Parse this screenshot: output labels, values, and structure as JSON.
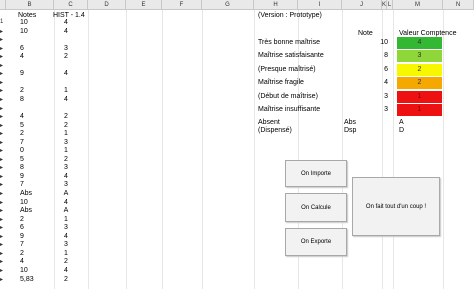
{
  "columns": [
    "B",
    "C",
    "D",
    "E",
    "F",
    "G",
    "H",
    "I",
    "J",
    "K",
    "L",
    "M",
    "N"
  ],
  "col_headers": {
    "B": "Notes",
    "C": "HIST - 1.4"
  },
  "rows": [
    {
      "a": "1",
      "b": "10",
      "c": "4"
    },
    {
      "a": "▸",
      "b": "10",
      "c": "4"
    },
    {
      "a": "▸",
      "b": "",
      "c": ""
    },
    {
      "a": "▸",
      "b": "6",
      "c": "3"
    },
    {
      "a": "▸",
      "b": "4",
      "c": "2"
    },
    {
      "a": "▸",
      "b": "",
      "c": ""
    },
    {
      "a": "▸",
      "b": "9",
      "c": "4"
    },
    {
      "a": "▸",
      "b": "",
      "c": ""
    },
    {
      "a": "▸",
      "b": "2",
      "c": "1"
    },
    {
      "a": "▸",
      "b": "8",
      "c": "4"
    },
    {
      "a": "▸",
      "b": "",
      "c": ""
    },
    {
      "a": "▸",
      "b": "4",
      "c": "2"
    },
    {
      "a": "▸",
      "b": "5",
      "c": "2"
    },
    {
      "a": "▸",
      "b": "2",
      "c": "1"
    },
    {
      "a": "▸",
      "b": "7",
      "c": "3"
    },
    {
      "a": "▸",
      "b": "0",
      "c": "1"
    },
    {
      "a": "▸",
      "b": "5",
      "c": "2"
    },
    {
      "a": "▸",
      "b": "8",
      "c": "3"
    },
    {
      "a": "▸",
      "b": "9",
      "c": "4"
    },
    {
      "a": "▸",
      "b": "7",
      "c": "3"
    },
    {
      "a": "▸",
      "b": "Abs",
      "c": "A"
    },
    {
      "a": "▸",
      "b": "10",
      "c": "4"
    },
    {
      "a": "▸",
      "b": "Abs",
      "c": "A"
    },
    {
      "a": "▸",
      "b": "2",
      "c": "1"
    },
    {
      "a": "▸",
      "b": "6",
      "c": "3"
    },
    {
      "a": "▸",
      "b": "9",
      "c": "4"
    },
    {
      "a": "▸",
      "b": "7",
      "c": "3"
    },
    {
      "a": "▸",
      "b": "2",
      "c": "1"
    },
    {
      "a": "▸",
      "b": "4",
      "c": "2"
    },
    {
      "a": "▸",
      "b": "10",
      "c": "4"
    },
    {
      "a": "▸",
      "b": "5,83",
      "c": "2"
    }
  ],
  "version": "(Version : Prototype)",
  "legend": {
    "note_header": "Note",
    "valeur_header": "Valeur Comptence"
  },
  "levels": [
    {
      "label": "Très bonne maîtrise",
      "note": "10",
      "valeur": "4",
      "color": "#33b833"
    },
    {
      "label": "Maîtrise satisfaisante",
      "note": "8",
      "valeur": "3",
      "color": "#8ed63a"
    },
    {
      "label": "(Presque maîtrisé)",
      "note": "6",
      "valeur": "2",
      "color": "#f7f700"
    },
    {
      "label": "Maîtrise fragile",
      "note": "4",
      "valeur": "2",
      "color": "#f5a800"
    },
    {
      "label": "(Début de maîtrise)",
      "note": "3",
      "valeur": "1",
      "color": "#ee1111"
    },
    {
      "label": "Maîtrise insuffisante",
      "note": "3",
      "valeur": "1",
      "color": "#ee1111"
    }
  ],
  "special": [
    {
      "label": "Absent",
      "code": "Abs",
      "value": "A"
    },
    {
      "label": "(Dispensé)",
      "code": "Dsp",
      "value": "D"
    }
  ],
  "buttons": {
    "importe": "On Importe",
    "calcule": "On Calcule",
    "exporte": "On Exporte",
    "all": "On fait tout d'un coup !"
  }
}
